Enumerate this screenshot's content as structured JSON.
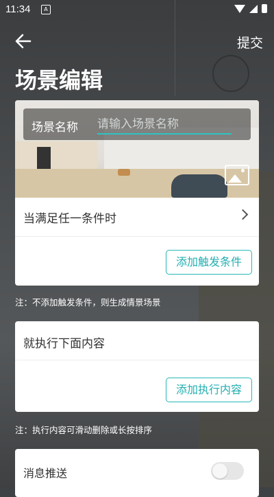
{
  "status_bar": {
    "time": "11:34",
    "notification_glyph": "A"
  },
  "top_bar": {
    "submit_label": "提交"
  },
  "page_title": "场景编辑",
  "scene_name": {
    "label": "场景名称",
    "placeholder": "请输入场景名称",
    "value": ""
  },
  "conditions": {
    "header": "当满足任一条件时",
    "add_button": "添加触发条件",
    "note": "注：不添加触发条件，则生成情景场景"
  },
  "actions": {
    "header": "就执行下面内容",
    "add_button": "添加执行内容",
    "note": "注：执行内容可滑动删除或长按排序"
  },
  "push": {
    "label": "消息推送",
    "enabled": false
  },
  "colors": {
    "accent": "#27b7b7",
    "background": "#3f4244"
  },
  "icons": [
    "back-arrow-icon",
    "image-picker-icon",
    "chevron-right-icon",
    "wifi-icon",
    "cellular-icon",
    "battery-icon"
  ]
}
